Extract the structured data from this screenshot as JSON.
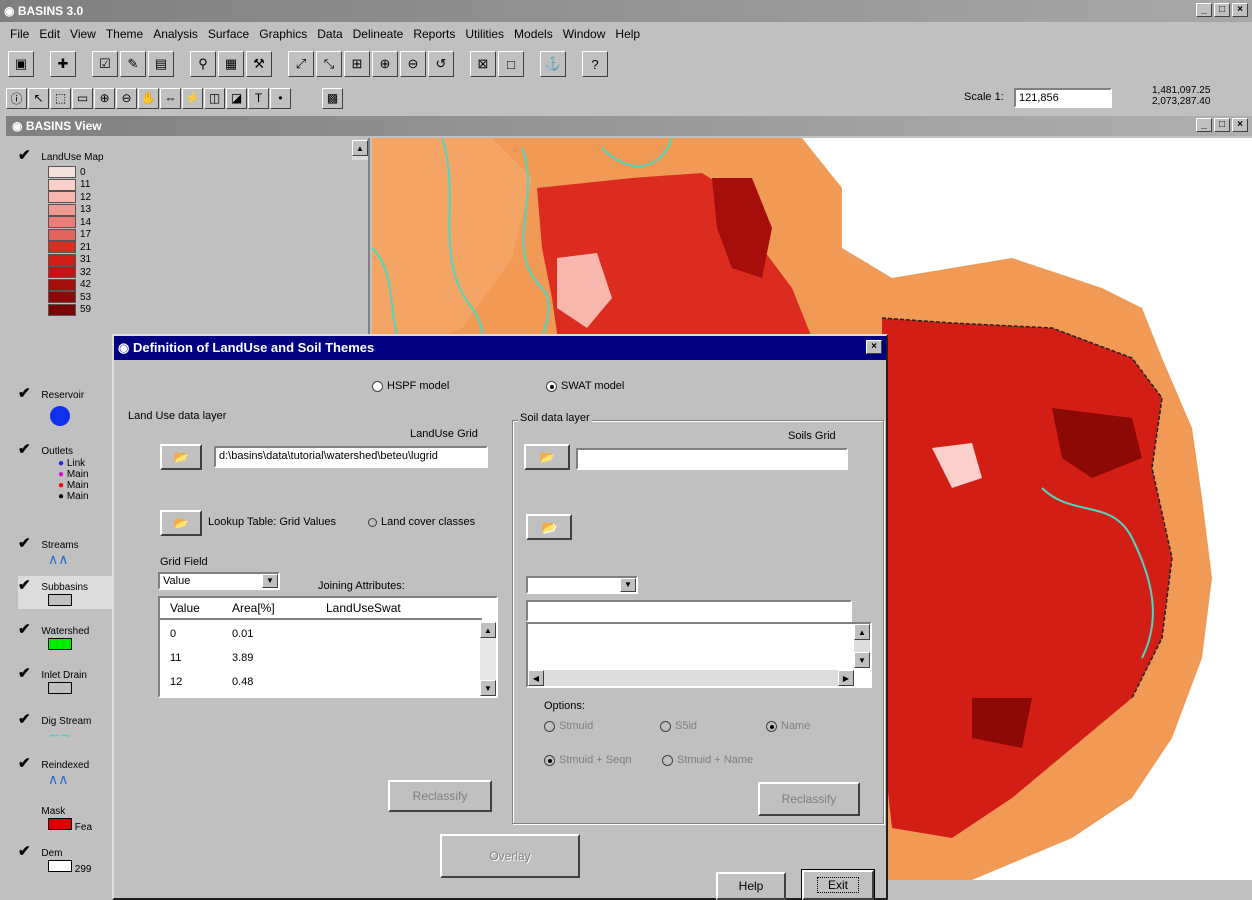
{
  "app": {
    "title": "BASINS 3.0"
  },
  "menu": [
    "File",
    "Edit",
    "View",
    "Theme",
    "Analysis",
    "Surface",
    "Graphics",
    "Data",
    "Delineate",
    "Reports",
    "Utilities",
    "Models",
    "Window",
    "Help"
  ],
  "toolbar2": {
    "scale_label": "Scale 1:",
    "scale_value": "121,856",
    "coords": [
      "1,481,097.25",
      "2,073,287.40"
    ]
  },
  "view": {
    "title": "BASINS View"
  },
  "toc": {
    "landuse": {
      "name": "LandUse Map",
      "values": [
        "0",
        "11",
        "12",
        "13",
        "14",
        "17",
        "21",
        "31",
        "32",
        "42",
        "53",
        "59"
      ]
    },
    "reservoir": {
      "name": "Reservoir"
    },
    "outlets": {
      "name": "Outlets",
      "items": [
        "Link",
        "Main",
        "Main",
        "Main"
      ]
    },
    "streams": {
      "name": "Streams"
    },
    "subbasins": {
      "name": "Subbasins"
    },
    "watershed": {
      "name": "Watershed"
    },
    "inlet": {
      "name": "Inlet Drain"
    },
    "dig_stream": {
      "name": "Dig Stream"
    },
    "reindex": {
      "name": "Reindexed"
    },
    "mask": {
      "name": "Mask",
      "sub": "Fea"
    },
    "dem": {
      "name": "Dem",
      "sub": "299"
    }
  },
  "dialog": {
    "title": "Definition of LandUse and Soil Themes",
    "model_hspf": "HSPF model",
    "model_swat": "SWAT model",
    "landuse": {
      "group_label": "Land Use data layer",
      "grid_label": "LandUse Grid",
      "grid_path": "d:\\basins\\data\\tutorial\\watershed\\beteu\\lugrid",
      "lookup_label": "Lookup Table: Grid Values",
      "landcover_label": "Land cover classes",
      "grid_field_label": "Grid Field",
      "grid_field_value": "Value",
      "joining_label": "Joining Attributes:",
      "columns": [
        "Value",
        "Area[%]",
        "LandUseSwat"
      ],
      "rows": [
        {
          "value": "0",
          "area": "0.01",
          "swat": ""
        },
        {
          "value": "11",
          "area": "3.89",
          "swat": ""
        },
        {
          "value": "12",
          "area": "0.48",
          "swat": ""
        }
      ],
      "reclassify": "Reclassify"
    },
    "soil": {
      "group_label": "Soil data layer",
      "grid_label": "Soils Grid",
      "options_label": "Options:",
      "opt_stmuid": "Stmuid",
      "opt_s5id": "S5id",
      "opt_name": "Name",
      "opt_stmuid_seqn": "Stmuid + Seqn",
      "opt_stmuid_name": "Stmuid + Name",
      "reclassify": "Reclassify"
    },
    "overlay": "Overlay",
    "help": "Help",
    "exit": "Exit"
  },
  "colors": {
    "landuse": [
      "#f5e1dc",
      "#fbd0cb",
      "#f7b6ae",
      "#f19a92",
      "#eb7f77",
      "#e3645c",
      "#dc2c20",
      "#d31e16",
      "#c0160f",
      "#a50e0b",
      "#8d0906",
      "#7a0405"
    ],
    "watershed_orange": "#f09a55",
    "stream": "#4fd6c0",
    "reservoir": "#1030f0",
    "watershed_swatch": "#00ee00",
    "mask_swatch": "#e00000"
  }
}
